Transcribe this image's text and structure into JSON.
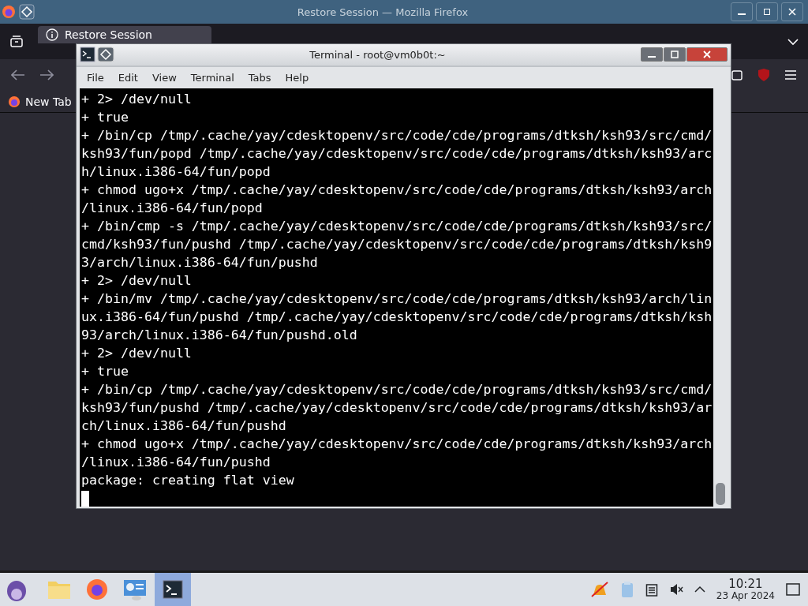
{
  "browser": {
    "title": "Restore Session — Mozilla Firefox",
    "tabs": [
      {
        "label": "Restore Session",
        "selected": true
      }
    ],
    "bookmarks": [
      "New Tab"
    ]
  },
  "terminal": {
    "title": "Terminal - root@vm0b0t:~",
    "menu": [
      "File",
      "Edit",
      "View",
      "Terminal",
      "Tabs",
      "Help"
    ],
    "lines": [
      "+ 2> /dev/null",
      "+ true",
      "+ /bin/cp /tmp/.cache/yay/cdesktopenv/src/code/cde/programs/dtksh/ksh93/src/cmd/",
      "ksh93/fun/popd /tmp/.cache/yay/cdesktopenv/src/code/cde/programs/dtksh/ksh93/arc",
      "h/linux.i386-64/fun/popd",
      "+ chmod ugo+x /tmp/.cache/yay/cdesktopenv/src/code/cde/programs/dtksh/ksh93/arch",
      "/linux.i386-64/fun/popd",
      "+ /bin/cmp -s /tmp/.cache/yay/cdesktopenv/src/code/cde/programs/dtksh/ksh93/src/",
      "cmd/ksh93/fun/pushd /tmp/.cache/yay/cdesktopenv/src/code/cde/programs/dtksh/ksh9",
      "3/arch/linux.i386-64/fun/pushd",
      "+ 2> /dev/null",
      "+ /bin/mv /tmp/.cache/yay/cdesktopenv/src/code/cde/programs/dtksh/ksh93/arch/lin",
      "ux.i386-64/fun/pushd /tmp/.cache/yay/cdesktopenv/src/code/cde/programs/dtksh/ksh",
      "93/arch/linux.i386-64/fun/pushd.old",
      "+ 2> /dev/null",
      "+ true",
      "+ /bin/cp /tmp/.cache/yay/cdesktopenv/src/code/cde/programs/dtksh/ksh93/src/cmd/",
      "ksh93/fun/pushd /tmp/.cache/yay/cdesktopenv/src/code/cde/programs/dtksh/ksh93/ar",
      "ch/linux.i386-64/fun/pushd",
      "+ chmod ugo+x /tmp/.cache/yay/cdesktopenv/src/code/cde/programs/dtksh/ksh93/arch",
      "/linux.i386-64/fun/pushd",
      "package: creating flat view"
    ]
  },
  "taskbar": {
    "apps": [
      {
        "kind": "files",
        "selected": false
      },
      {
        "kind": "browser",
        "selected": false
      },
      {
        "kind": "settings",
        "selected": false
      },
      {
        "kind": "terminal",
        "selected": true
      }
    ],
    "time": "10:21",
    "date": "23 Apr 2024"
  }
}
